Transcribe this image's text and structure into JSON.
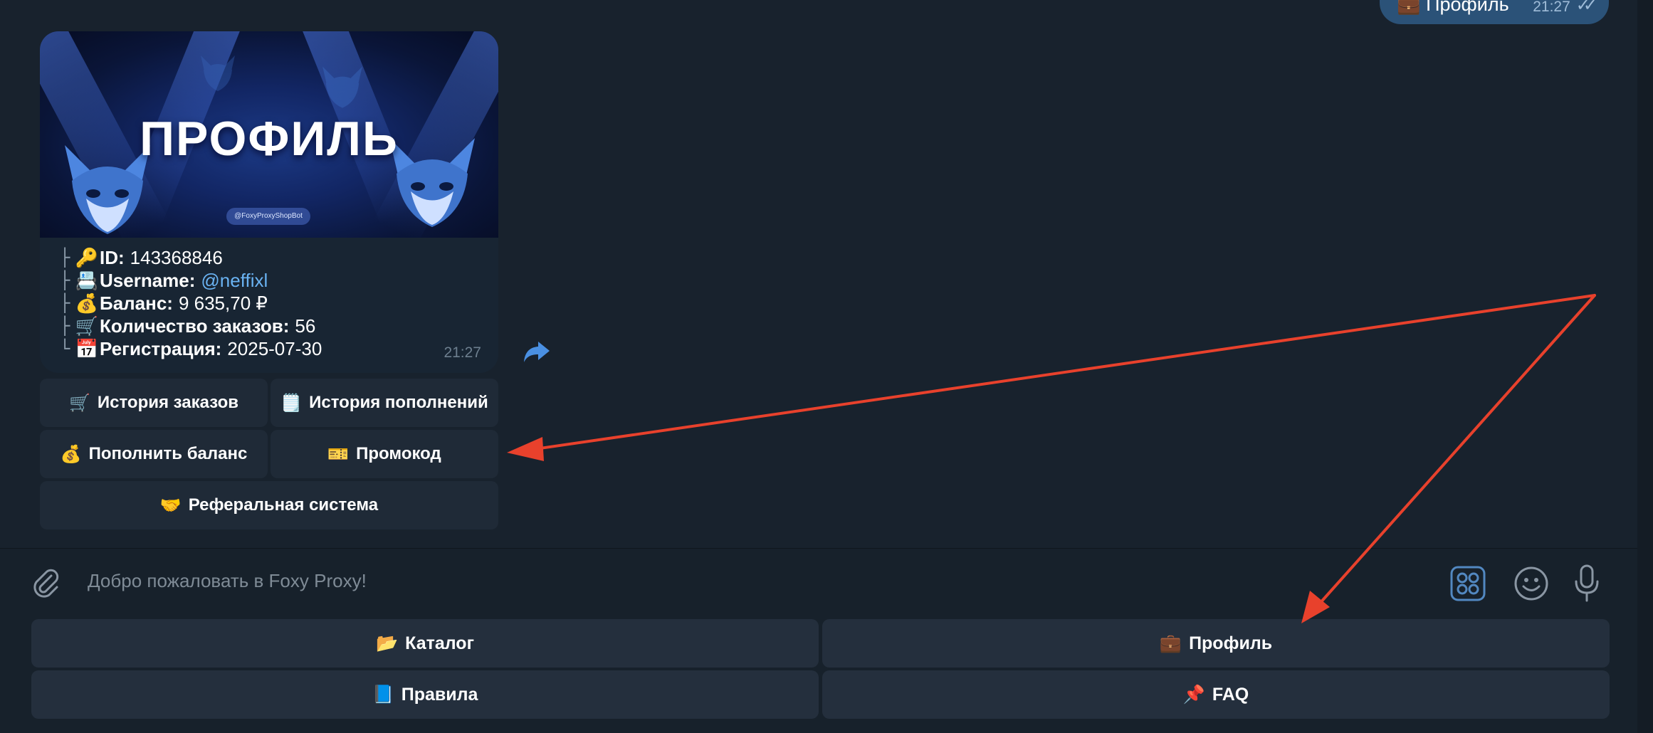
{
  "outgoing_message": {
    "text": "💼 Профиль",
    "time": "21:27",
    "ticks": "✓✓"
  },
  "incoming_message": {
    "banner": {
      "title": "ПРОФИЛЬ",
      "tag": "@FoxyProxyShopBot"
    },
    "info": [
      {
        "tree": "├",
        "icon": "🔑",
        "label": "ID:",
        "value": "143368846"
      },
      {
        "tree": "├",
        "icon": "📇",
        "label": "Username:",
        "value": "@neffixl"
      },
      {
        "tree": "├",
        "icon": "💰",
        "label": "Баланс:",
        "value": "9 635,70 ₽"
      },
      {
        "tree": "├",
        "icon": "🛒",
        "label": "Количество заказов:",
        "value": "56"
      },
      {
        "tree": "└",
        "icon": "📅",
        "label": "Регистрация:",
        "value": "2025-07-30"
      }
    ],
    "time": "21:27"
  },
  "inline_keyboard": {
    "order_history": {
      "emoji": "🛒",
      "label": "История заказов"
    },
    "topup_history": {
      "emoji": "🗒️",
      "label": "История пополнений"
    },
    "topup_balance": {
      "emoji": "💰",
      "label": "Пополнить баланс"
    },
    "promo_code": {
      "emoji": "🎫",
      "label": "Промокод"
    },
    "referral": {
      "emoji": "🤝",
      "label": "Реферальная система"
    }
  },
  "composer": {
    "placeholder": "Добро пожаловать в Foxy Proxy!"
  },
  "reply_keyboard": {
    "catalog": {
      "emoji": "📂",
      "label": "Каталог"
    },
    "profile": {
      "emoji": "💼",
      "label": "Профиль"
    },
    "rules": {
      "emoji": "📘",
      "label": "Правила"
    },
    "faq": {
      "emoji": "📌",
      "label": "FAQ"
    }
  },
  "colors": {
    "background": "#18222d",
    "bubble_in": "#182533",
    "bubble_out": "#2b5278",
    "link": "#6ab3f3",
    "accent": "#5288c1",
    "annotation_arrow": "#e8412c"
  }
}
